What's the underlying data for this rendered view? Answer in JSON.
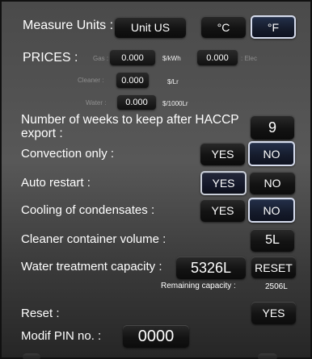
{
  "measure_units": {
    "label": "Measure Units :",
    "unit_value": "Unit US",
    "celsius": "°C",
    "fahrenheit": "°F"
  },
  "prices": {
    "label": "PRICES :",
    "gas_label": "Gas :",
    "gas_value": "0.000",
    "gas_unit": "$/kWh",
    "elec_value": "0.000",
    "elec_label": ": Elec",
    "cleaner_label": "Cleaner :",
    "cleaner_value": "0.000",
    "cleaner_unit": "$/Lr",
    "water_label": "Water :",
    "water_value": "0.000",
    "water_unit": "$/1000Lr"
  },
  "haccp": {
    "label": "Number of weeks to keep after HACCP export :",
    "value": "9"
  },
  "convection_only": {
    "label": "Convection only :",
    "yes": "YES",
    "no": "NO"
  },
  "auto_restart": {
    "label": "Auto restart :",
    "yes": "YES",
    "no": "NO"
  },
  "cooling_condensates": {
    "label": "Cooling of condensates :",
    "yes": "YES",
    "no": "NO"
  },
  "cleaner_volume": {
    "label": "Cleaner container volume  :",
    "value": "5L"
  },
  "water_treatment": {
    "label": "Water treatment capacity :",
    "value": "5326L",
    "reset": "RESET",
    "remaining_label": "Remaining capacity :",
    "remaining_value": "2506L"
  },
  "reset": {
    "label": "Reset :",
    "yes": "YES"
  },
  "pin": {
    "label": "Modif PIN no. :",
    "value": "0000"
  },
  "colors": {
    "selected_border": "#d6dced",
    "button_dark": "#131313"
  }
}
